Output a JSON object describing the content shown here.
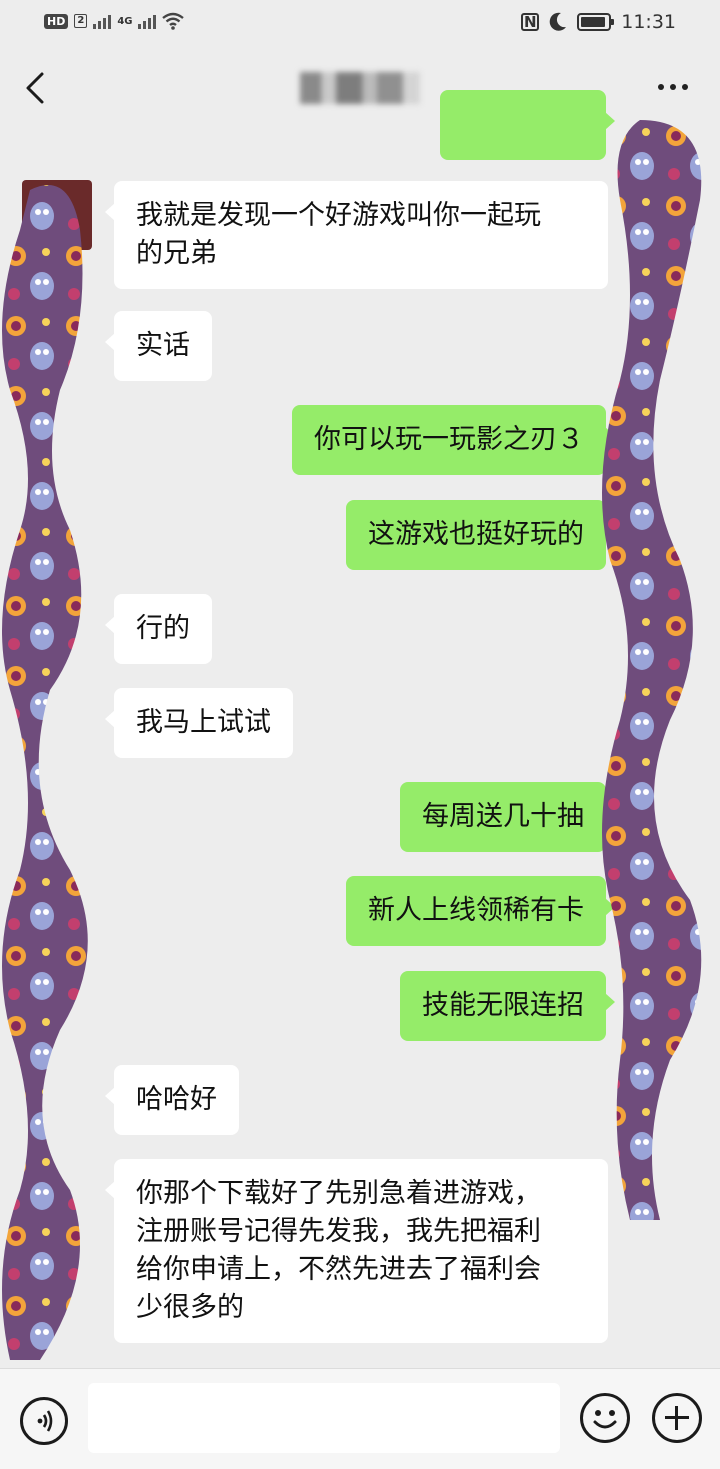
{
  "status_bar": {
    "hd_label": "HD",
    "sim_label": "2",
    "network_label": "4G",
    "time": "11:31"
  },
  "header": {
    "title": "▇▆▇▇▆"
  },
  "messages": [
    {
      "side": "in",
      "text": "我就是发现一个好游戏叫你一起玩\n的兄弟"
    },
    {
      "side": "in",
      "text": "实话"
    },
    {
      "side": "out",
      "text": "你可以玩一玩影之刃３"
    },
    {
      "side": "out",
      "text": "这游戏也挺好玩的"
    },
    {
      "side": "in",
      "text": "行的"
    },
    {
      "side": "in",
      "text": "我马上试试"
    },
    {
      "side": "out",
      "text": "每周送几十抽"
    },
    {
      "side": "out",
      "text": "新人上线领稀有卡"
    },
    {
      "side": "out",
      "text": "技能无限连招"
    },
    {
      "side": "in",
      "text": "哈哈好"
    },
    {
      "side": "in",
      "text": "你那个下载好了先别急着进游戏，\n注册账号记得先发我，我先把福利\n给你申请上，不然先进去了福利会\n少很多的"
    }
  ],
  "colors": {
    "background": "#ededed",
    "incoming_bubble": "#ffffff",
    "outgoing_bubble": "#95ec69",
    "privacy_overlay": "#6f4c7c"
  },
  "icons": {
    "back": "back-arrow-icon",
    "more": "more-dots-icon",
    "voice": "voice-icon",
    "emoji": "emoji-icon",
    "plus": "plus-icon"
  }
}
